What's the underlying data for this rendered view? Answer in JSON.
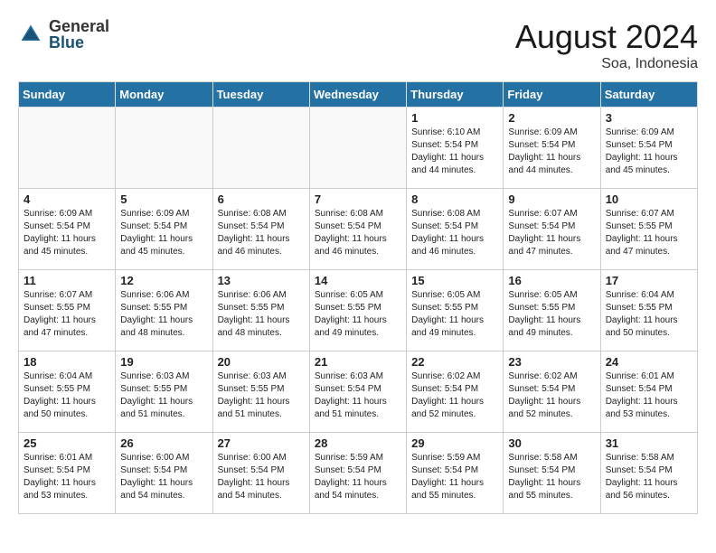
{
  "header": {
    "logo_general": "General",
    "logo_blue": "Blue",
    "month_title": "August 2024",
    "location": "Soa, Indonesia"
  },
  "weekdays": [
    "Sunday",
    "Monday",
    "Tuesday",
    "Wednesday",
    "Thursday",
    "Friday",
    "Saturday"
  ],
  "weeks": [
    [
      {
        "day": "",
        "sunrise": "",
        "sunset": "",
        "daylight": "",
        "empty": true
      },
      {
        "day": "",
        "sunrise": "",
        "sunset": "",
        "daylight": "",
        "empty": true
      },
      {
        "day": "",
        "sunrise": "",
        "sunset": "",
        "daylight": "",
        "empty": true
      },
      {
        "day": "",
        "sunrise": "",
        "sunset": "",
        "daylight": "",
        "empty": true
      },
      {
        "day": "1",
        "sunrise": "Sunrise: 6:10 AM",
        "sunset": "Sunset: 5:54 PM",
        "daylight": "Daylight: 11 hours and 44 minutes.",
        "empty": false
      },
      {
        "day": "2",
        "sunrise": "Sunrise: 6:09 AM",
        "sunset": "Sunset: 5:54 PM",
        "daylight": "Daylight: 11 hours and 44 minutes.",
        "empty": false
      },
      {
        "day": "3",
        "sunrise": "Sunrise: 6:09 AM",
        "sunset": "Sunset: 5:54 PM",
        "daylight": "Daylight: 11 hours and 45 minutes.",
        "empty": false
      }
    ],
    [
      {
        "day": "4",
        "sunrise": "Sunrise: 6:09 AM",
        "sunset": "Sunset: 5:54 PM",
        "daylight": "Daylight: 11 hours and 45 minutes.",
        "empty": false
      },
      {
        "day": "5",
        "sunrise": "Sunrise: 6:09 AM",
        "sunset": "Sunset: 5:54 PM",
        "daylight": "Daylight: 11 hours and 45 minutes.",
        "empty": false
      },
      {
        "day": "6",
        "sunrise": "Sunrise: 6:08 AM",
        "sunset": "Sunset: 5:54 PM",
        "daylight": "Daylight: 11 hours and 46 minutes.",
        "empty": false
      },
      {
        "day": "7",
        "sunrise": "Sunrise: 6:08 AM",
        "sunset": "Sunset: 5:54 PM",
        "daylight": "Daylight: 11 hours and 46 minutes.",
        "empty": false
      },
      {
        "day": "8",
        "sunrise": "Sunrise: 6:08 AM",
        "sunset": "Sunset: 5:54 PM",
        "daylight": "Daylight: 11 hours and 46 minutes.",
        "empty": false
      },
      {
        "day": "9",
        "sunrise": "Sunrise: 6:07 AM",
        "sunset": "Sunset: 5:54 PM",
        "daylight": "Daylight: 11 hours and 47 minutes.",
        "empty": false
      },
      {
        "day": "10",
        "sunrise": "Sunrise: 6:07 AM",
        "sunset": "Sunset: 5:55 PM",
        "daylight": "Daylight: 11 hours and 47 minutes.",
        "empty": false
      }
    ],
    [
      {
        "day": "11",
        "sunrise": "Sunrise: 6:07 AM",
        "sunset": "Sunset: 5:55 PM",
        "daylight": "Daylight: 11 hours and 47 minutes.",
        "empty": false
      },
      {
        "day": "12",
        "sunrise": "Sunrise: 6:06 AM",
        "sunset": "Sunset: 5:55 PM",
        "daylight": "Daylight: 11 hours and 48 minutes.",
        "empty": false
      },
      {
        "day": "13",
        "sunrise": "Sunrise: 6:06 AM",
        "sunset": "Sunset: 5:55 PM",
        "daylight": "Daylight: 11 hours and 48 minutes.",
        "empty": false
      },
      {
        "day": "14",
        "sunrise": "Sunrise: 6:05 AM",
        "sunset": "Sunset: 5:55 PM",
        "daylight": "Daylight: 11 hours and 49 minutes.",
        "empty": false
      },
      {
        "day": "15",
        "sunrise": "Sunrise: 6:05 AM",
        "sunset": "Sunset: 5:55 PM",
        "daylight": "Daylight: 11 hours and 49 minutes.",
        "empty": false
      },
      {
        "day": "16",
        "sunrise": "Sunrise: 6:05 AM",
        "sunset": "Sunset: 5:55 PM",
        "daylight": "Daylight: 11 hours and 49 minutes.",
        "empty": false
      },
      {
        "day": "17",
        "sunrise": "Sunrise: 6:04 AM",
        "sunset": "Sunset: 5:55 PM",
        "daylight": "Daylight: 11 hours and 50 minutes.",
        "empty": false
      }
    ],
    [
      {
        "day": "18",
        "sunrise": "Sunrise: 6:04 AM",
        "sunset": "Sunset: 5:55 PM",
        "daylight": "Daylight: 11 hours and 50 minutes.",
        "empty": false
      },
      {
        "day": "19",
        "sunrise": "Sunrise: 6:03 AM",
        "sunset": "Sunset: 5:55 PM",
        "daylight": "Daylight: 11 hours and 51 minutes.",
        "empty": false
      },
      {
        "day": "20",
        "sunrise": "Sunrise: 6:03 AM",
        "sunset": "Sunset: 5:55 PM",
        "daylight": "Daylight: 11 hours and 51 minutes.",
        "empty": false
      },
      {
        "day": "21",
        "sunrise": "Sunrise: 6:03 AM",
        "sunset": "Sunset: 5:54 PM",
        "daylight": "Daylight: 11 hours and 51 minutes.",
        "empty": false
      },
      {
        "day": "22",
        "sunrise": "Sunrise: 6:02 AM",
        "sunset": "Sunset: 5:54 PM",
        "daylight": "Daylight: 11 hours and 52 minutes.",
        "empty": false
      },
      {
        "day": "23",
        "sunrise": "Sunrise: 6:02 AM",
        "sunset": "Sunset: 5:54 PM",
        "daylight": "Daylight: 11 hours and 52 minutes.",
        "empty": false
      },
      {
        "day": "24",
        "sunrise": "Sunrise: 6:01 AM",
        "sunset": "Sunset: 5:54 PM",
        "daylight": "Daylight: 11 hours and 53 minutes.",
        "empty": false
      }
    ],
    [
      {
        "day": "25",
        "sunrise": "Sunrise: 6:01 AM",
        "sunset": "Sunset: 5:54 PM",
        "daylight": "Daylight: 11 hours and 53 minutes.",
        "empty": false
      },
      {
        "day": "26",
        "sunrise": "Sunrise: 6:00 AM",
        "sunset": "Sunset: 5:54 PM",
        "daylight": "Daylight: 11 hours and 54 minutes.",
        "empty": false
      },
      {
        "day": "27",
        "sunrise": "Sunrise: 6:00 AM",
        "sunset": "Sunset: 5:54 PM",
        "daylight": "Daylight: 11 hours and 54 minutes.",
        "empty": false
      },
      {
        "day": "28",
        "sunrise": "Sunrise: 5:59 AM",
        "sunset": "Sunset: 5:54 PM",
        "daylight": "Daylight: 11 hours and 54 minutes.",
        "empty": false
      },
      {
        "day": "29",
        "sunrise": "Sunrise: 5:59 AM",
        "sunset": "Sunset: 5:54 PM",
        "daylight": "Daylight: 11 hours and 55 minutes.",
        "empty": false
      },
      {
        "day": "30",
        "sunrise": "Sunrise: 5:58 AM",
        "sunset": "Sunset: 5:54 PM",
        "daylight": "Daylight: 11 hours and 55 minutes.",
        "empty": false
      },
      {
        "day": "31",
        "sunrise": "Sunrise: 5:58 AM",
        "sunset": "Sunset: 5:54 PM",
        "daylight": "Daylight: 11 hours and 56 minutes.",
        "empty": false
      }
    ]
  ]
}
